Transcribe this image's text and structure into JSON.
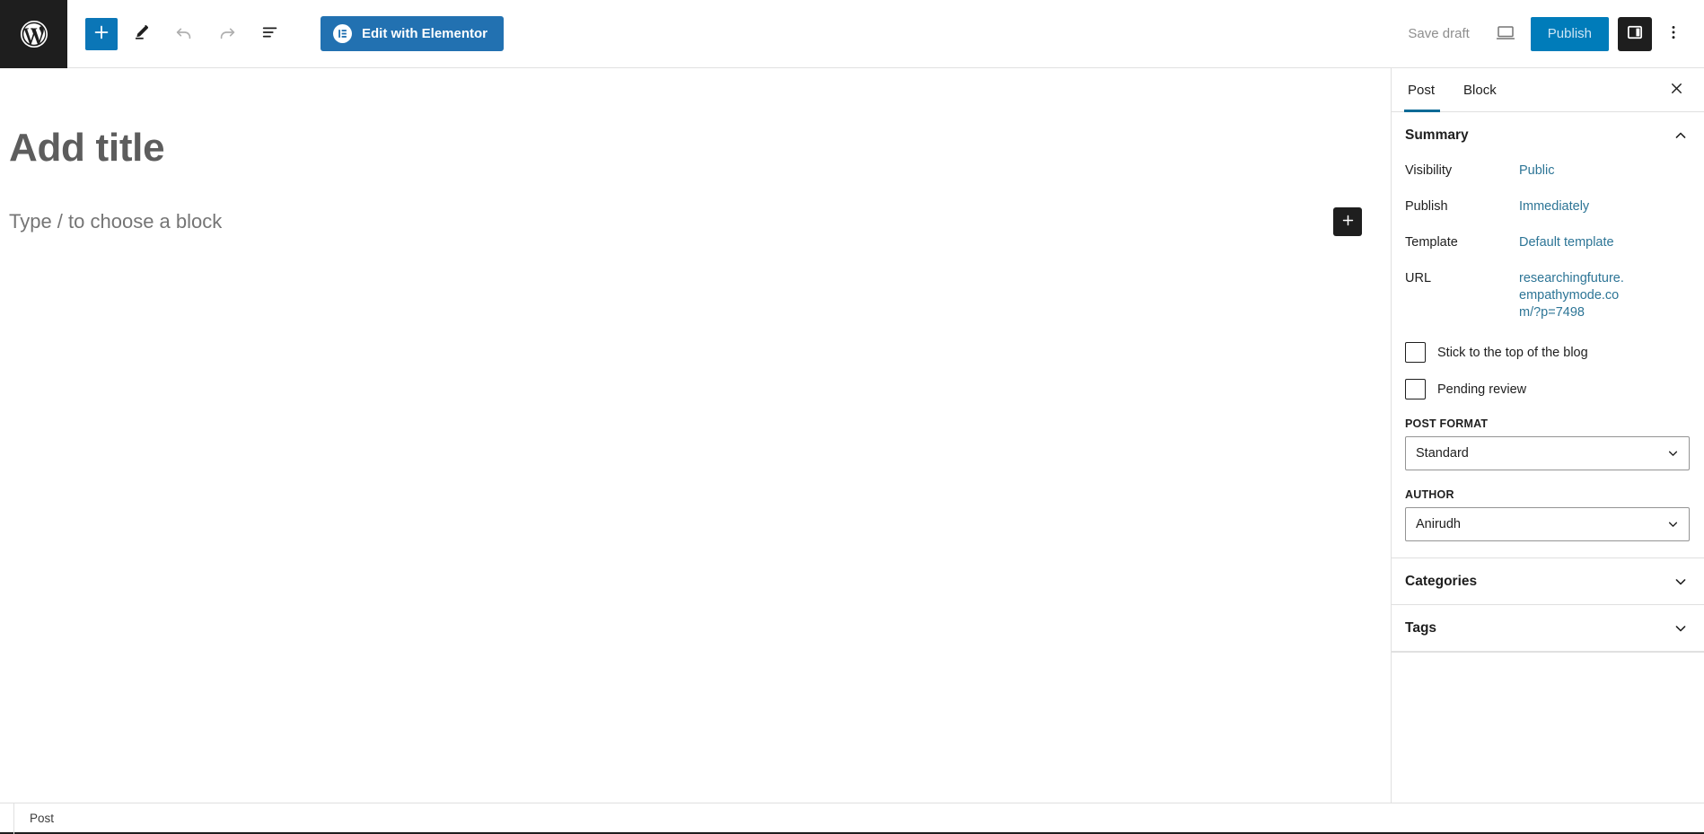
{
  "toolbar": {
    "logo_icon": "wordpress-logo-icon",
    "inserter_label": "+",
    "inserter_icon": "plus-icon",
    "tools_icon": "pencil-icon",
    "undo_icon": "undo-icon",
    "redo_icon": "redo-icon",
    "outline_icon": "document-outline-icon",
    "elementor_label": "Edit with Elementor",
    "elementor_icon": "elementor-logo-icon",
    "save_draft_label": "Save draft",
    "preview_icon": "desktop-preview-icon",
    "publish_label": "Publish",
    "sidebar_toggle_icon": "sidebar-panel-icon",
    "more_icon": "more-vertical-icon",
    "accent_blue": "#007cba",
    "elementor_blue": "#2271b1",
    "dark": "#1e1e1e"
  },
  "canvas": {
    "title_placeholder": "Add title",
    "block_placeholder": "Type / to choose a block",
    "inserter_icon": "plus-icon"
  },
  "sidebar": {
    "tabs": [
      {
        "label": "Post",
        "active": true
      },
      {
        "label": "Block",
        "active": false
      }
    ],
    "close_icon": "close-icon",
    "summary": {
      "title": "Summary",
      "chevron_icon": "chevron-up-icon",
      "rows": [
        {
          "label": "Visibility",
          "value": "Public"
        },
        {
          "label": "Publish",
          "value": "Immediately"
        },
        {
          "label": "Template",
          "value": "Default template"
        },
        {
          "label": "URL",
          "value": "researchingfuture.empathymode.com/?p=7498"
        }
      ],
      "checkboxes": [
        {
          "label": "Stick to the top of the blog",
          "checked": false
        },
        {
          "label": "Pending review",
          "checked": false
        }
      ],
      "post_format": {
        "label": "POST FORMAT",
        "value": "Standard",
        "chevron_icon": "chevron-down-icon"
      },
      "author": {
        "label": "AUTHOR",
        "value": "Anirudh",
        "chevron_icon": "chevron-down-icon"
      }
    },
    "categories": {
      "title": "Categories",
      "chevron_icon": "chevron-down-icon"
    },
    "tags": {
      "title": "Tags",
      "chevron_icon": "chevron-down-icon"
    }
  },
  "statusbar": {
    "label": "Post"
  }
}
